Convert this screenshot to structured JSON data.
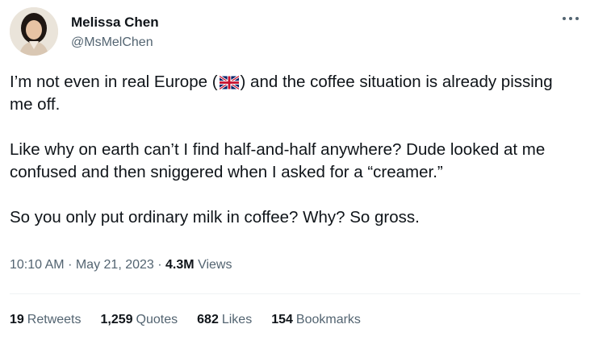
{
  "author": {
    "display_name": "Melissa Chen",
    "handle": "@MsMelChen"
  },
  "icons": {
    "more": "more-horizontal-icon",
    "flag": "uk-flag-emoji"
  },
  "tweet": {
    "line1_before_flag": "I’m not even in real Europe (",
    "line1_after_flag": ") and the coffee situation is already pissing me off.",
    "para2": "Like why on earth can’t I find half-and-half anywhere? Dude looked at me confused and then sniggered when I asked for a “creamer.”",
    "para3": "So you only put ordinary milk in coffee? Why? So gross."
  },
  "meta": {
    "time": "10:10 AM",
    "date": "May 21, 2023",
    "views_count": "4.3M",
    "views_label": "Views",
    "separator": "·"
  },
  "stats": {
    "retweets_count": "19",
    "retweets_label": "Retweets",
    "quotes_count": "1,259",
    "quotes_label": "Quotes",
    "likes_count": "682",
    "likes_label": "Likes",
    "bookmarks_count": "154",
    "bookmarks_label": "Bookmarks"
  },
  "colors": {
    "text": "#0f1419",
    "secondary": "#536471",
    "divider": "#eff3f4"
  }
}
